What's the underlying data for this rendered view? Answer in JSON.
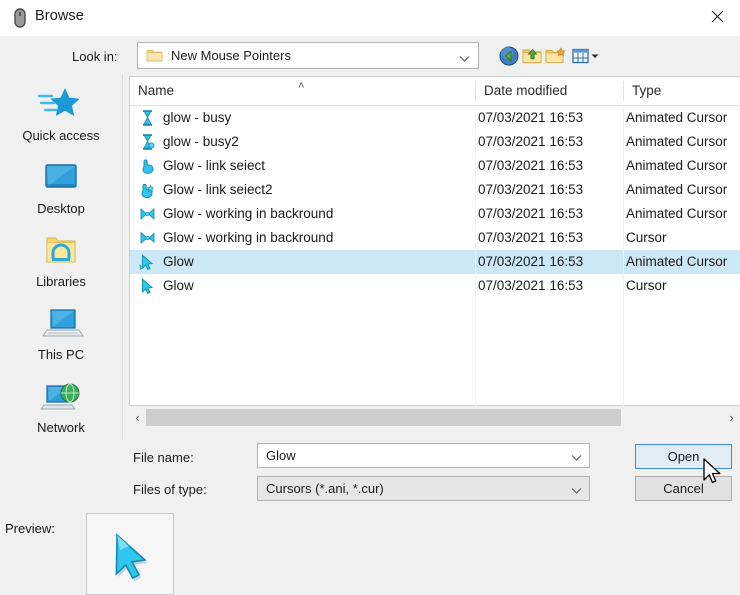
{
  "window": {
    "title": "Browse",
    "icon": "mouse-device-icon",
    "close_label": "✕"
  },
  "toolbar": {
    "lookin_label": "Look in:",
    "lookin_value": "New Mouse Pointers",
    "lookin_icon": "folder-icon",
    "buttons": [
      {
        "name": "back-button",
        "icon": "back-arrow-icon",
        "title": "Back"
      },
      {
        "name": "up-one-level-button",
        "icon": "up-folder-icon",
        "title": "Up One Level"
      },
      {
        "name": "new-folder-button",
        "icon": "new-folder-icon",
        "title": "Create New Folder"
      },
      {
        "name": "views-button",
        "icon": "views-grid-icon",
        "title": "Views"
      }
    ]
  },
  "sidebar": {
    "items": [
      {
        "label": "Quick access",
        "icon": "quick-access-star-icon"
      },
      {
        "label": "Desktop",
        "icon": "desktop-monitor-icon"
      },
      {
        "label": "Libraries",
        "icon": "libraries-folder-icon"
      },
      {
        "label": "This PC",
        "icon": "this-pc-laptop-icon"
      },
      {
        "label": "Network",
        "icon": "network-globe-icon"
      }
    ]
  },
  "file_list": {
    "columns": [
      "Name",
      "Date modified",
      "Type"
    ],
    "sort_column": "Name",
    "sort_direction": "ascending",
    "sort_glyph": "˄",
    "rows": [
      {
        "name": "glow - busy",
        "date": "07/03/2021 16:53",
        "type": "Animated Cursor",
        "icon": "cursor-busy-icon",
        "selected": false
      },
      {
        "name": "glow - busy2",
        "date": "07/03/2021 16:53",
        "type": "Animated Cursor",
        "icon": "cursor-busy2-icon",
        "selected": false
      },
      {
        "name": "Glow - link seiect",
        "date": "07/03/2021 16:53",
        "type": "Animated Cursor",
        "icon": "cursor-hand-icon",
        "selected": false
      },
      {
        "name": "Glow - link seiect2",
        "date": "07/03/2021 16:53",
        "type": "Animated Cursor",
        "icon": "cursor-hand2-icon",
        "selected": false
      },
      {
        "name": "Glow - working in backround",
        "date": "07/03/2021 16:53",
        "type": "Animated Cursor",
        "icon": "cursor-working-icon",
        "selected": false
      },
      {
        "name": "Glow - working in backround",
        "date": "07/03/2021 16:53",
        "type": "Cursor",
        "icon": "cursor-working2-icon",
        "selected": false
      },
      {
        "name": "Glow",
        "date": "07/03/2021 16:53",
        "type": "Animated Cursor",
        "icon": "cursor-arrow-anim-icon",
        "selected": true
      },
      {
        "name": "Glow",
        "date": "07/03/2021 16:53",
        "type": "Cursor",
        "icon": "cursor-arrow-icon",
        "selected": false
      }
    ]
  },
  "scrollbar": {
    "left_glyph": "‹",
    "right_glyph": "›"
  },
  "form": {
    "filename_label": "File name:",
    "filename_value": "Glow",
    "filetype_label": "Files of type:",
    "filetype_value": "Cursors (*.ani, *.cur)"
  },
  "buttons": {
    "open_label": "Open",
    "cancel_label": "Cancel"
  },
  "preview": {
    "label": "Preview:",
    "icon": "cursor-arrow-preview-icon"
  },
  "colors": {
    "selection": "#cce8f7",
    "focus_border": "#3d8bd4",
    "cursor_cyan": "#29c3f0",
    "window_bg": "#f0f0f0"
  }
}
